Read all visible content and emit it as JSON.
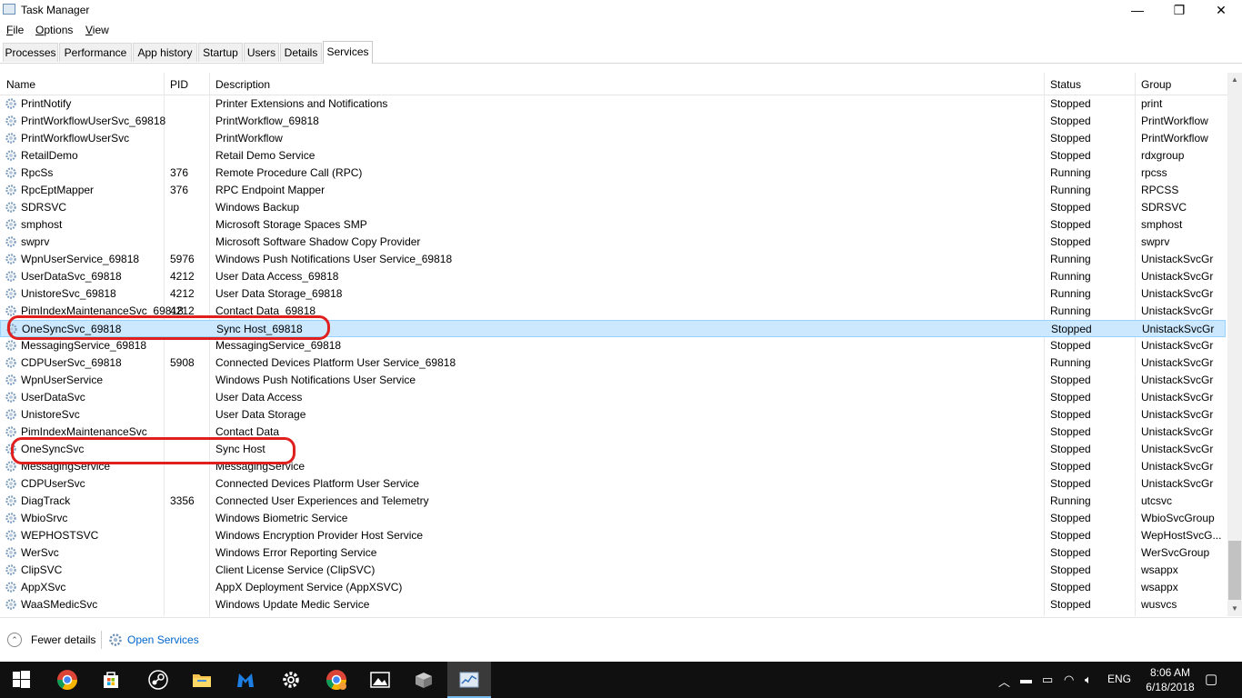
{
  "window": {
    "title": "Task Manager",
    "minimize": "—",
    "maximize": "❐",
    "close": "✕"
  },
  "menu": [
    {
      "key": "F",
      "rest": "ile"
    },
    {
      "key": "O",
      "rest": "ptions"
    },
    {
      "key": "V",
      "rest": "iew"
    }
  ],
  "tabs": [
    "Processes",
    "Performance",
    "App history",
    "Startup",
    "Users",
    "Details",
    "Services"
  ],
  "active_tab": "Services",
  "columns": {
    "name": "Name",
    "pid": "PID",
    "description": "Description",
    "status": "Status",
    "group": "Group"
  },
  "rows": [
    {
      "name": "PrintNotify",
      "pid": "",
      "description": "Printer Extensions and Notifications",
      "status": "Stopped",
      "group": "print"
    },
    {
      "name": "PrintWorkflowUserSvc_69818",
      "pid": "",
      "description": "PrintWorkflow_69818",
      "status": "Stopped",
      "group": "PrintWorkflow"
    },
    {
      "name": "PrintWorkflowUserSvc",
      "pid": "",
      "description": "PrintWorkflow",
      "status": "Stopped",
      "group": "PrintWorkflow"
    },
    {
      "name": "RetailDemo",
      "pid": "",
      "description": "Retail Demo Service",
      "status": "Stopped",
      "group": "rdxgroup"
    },
    {
      "name": "RpcSs",
      "pid": "376",
      "description": "Remote Procedure Call (RPC)",
      "status": "Running",
      "group": "rpcss"
    },
    {
      "name": "RpcEptMapper",
      "pid": "376",
      "description": "RPC Endpoint Mapper",
      "status": "Running",
      "group": "RPCSS"
    },
    {
      "name": "SDRSVC",
      "pid": "",
      "description": "Windows Backup",
      "status": "Stopped",
      "group": "SDRSVC"
    },
    {
      "name": "smphost",
      "pid": "",
      "description": "Microsoft Storage Spaces SMP",
      "status": "Stopped",
      "group": "smphost"
    },
    {
      "name": "swprv",
      "pid": "",
      "description": "Microsoft Software Shadow Copy Provider",
      "status": "Stopped",
      "group": "swprv"
    },
    {
      "name": "WpnUserService_69818",
      "pid": "5976",
      "description": "Windows Push Notifications User Service_69818",
      "status": "Running",
      "group": "UnistackSvcGr"
    },
    {
      "name": "UserDataSvc_69818",
      "pid": "4212",
      "description": "User Data Access_69818",
      "status": "Running",
      "group": "UnistackSvcGr"
    },
    {
      "name": "UnistoreSvc_69818",
      "pid": "4212",
      "description": "User Data Storage_69818",
      "status": "Running",
      "group": "UnistackSvcGr"
    },
    {
      "name": "PimIndexMaintenanceSvc_69818",
      "pid": "4212",
      "description": "Contact Data_69818",
      "status": "Running",
      "group": "UnistackSvcGr"
    },
    {
      "name": "OneSyncSvc_69818",
      "pid": "",
      "description": "Sync Host_69818",
      "status": "Stopped",
      "group": "UnistackSvcGr"
    },
    {
      "name": "MessagingService_69818",
      "pid": "",
      "description": "MessagingService_69818",
      "status": "Stopped",
      "group": "UnistackSvcGr"
    },
    {
      "name": "CDPUserSvc_69818",
      "pid": "5908",
      "description": "Connected Devices Platform User Service_69818",
      "status": "Running",
      "group": "UnistackSvcGr"
    },
    {
      "name": "WpnUserService",
      "pid": "",
      "description": "Windows Push Notifications User Service",
      "status": "Stopped",
      "group": "UnistackSvcGr"
    },
    {
      "name": "UserDataSvc",
      "pid": "",
      "description": "User Data Access",
      "status": "Stopped",
      "group": "UnistackSvcGr"
    },
    {
      "name": "UnistoreSvc",
      "pid": "",
      "description": "User Data Storage",
      "status": "Stopped",
      "group": "UnistackSvcGr"
    },
    {
      "name": "PimIndexMaintenanceSvc",
      "pid": "",
      "description": "Contact Data",
      "status": "Stopped",
      "group": "UnistackSvcGr"
    },
    {
      "name": "OneSyncSvc",
      "pid": "",
      "description": "Sync Host",
      "status": "Stopped",
      "group": "UnistackSvcGr"
    },
    {
      "name": "MessagingService",
      "pid": "",
      "description": "MessagingService",
      "status": "Stopped",
      "group": "UnistackSvcGr"
    },
    {
      "name": "CDPUserSvc",
      "pid": "",
      "description": "Connected Devices Platform User Service",
      "status": "Stopped",
      "group": "UnistackSvcGr"
    },
    {
      "name": "DiagTrack",
      "pid": "3356",
      "description": "Connected User Experiences and Telemetry",
      "status": "Running",
      "group": "utcsvc"
    },
    {
      "name": "WbioSrvc",
      "pid": "",
      "description": "Windows Biometric Service",
      "status": "Stopped",
      "group": "WbioSvcGroup"
    },
    {
      "name": "WEPHOSTSVC",
      "pid": "",
      "description": "Windows Encryption Provider Host Service",
      "status": "Stopped",
      "group": "WepHostSvcG..."
    },
    {
      "name": "WerSvc",
      "pid": "",
      "description": "Windows Error Reporting Service",
      "status": "Stopped",
      "group": "WerSvcGroup"
    },
    {
      "name": "ClipSVC",
      "pid": "",
      "description": "Client License Service (ClipSVC)",
      "status": "Stopped",
      "group": "wsappx"
    },
    {
      "name": "AppXSvc",
      "pid": "",
      "description": "AppX Deployment Service (AppXSVC)",
      "status": "Stopped",
      "group": "wsappx"
    },
    {
      "name": "WaaSMedicSvc",
      "pid": "",
      "description": "Windows Update Medic Service",
      "status": "Stopped",
      "group": "wusvcs"
    }
  ],
  "selected_row": 13,
  "annotations": [
    13,
    20
  ],
  "footer": {
    "fewer_details": "Fewer details",
    "open_services": "Open Services"
  },
  "taskbar": {
    "apps": [
      "start-icon",
      "chrome-icon",
      "store-icon",
      "steam-icon",
      "file-explorer-icon",
      "malwarebytes-icon",
      "settings-icon",
      "chrome-alt-icon",
      "photos-icon",
      "package-icon",
      "task-manager-icon"
    ],
    "active_app": "task-manager-icon",
    "language": "ENG",
    "time": "8:06 AM",
    "date": "6/18/2018"
  },
  "colors": {
    "selection": "#cce8ff",
    "annotation": "#e0201e",
    "link": "#0066cc",
    "taskbar": "#101010"
  }
}
